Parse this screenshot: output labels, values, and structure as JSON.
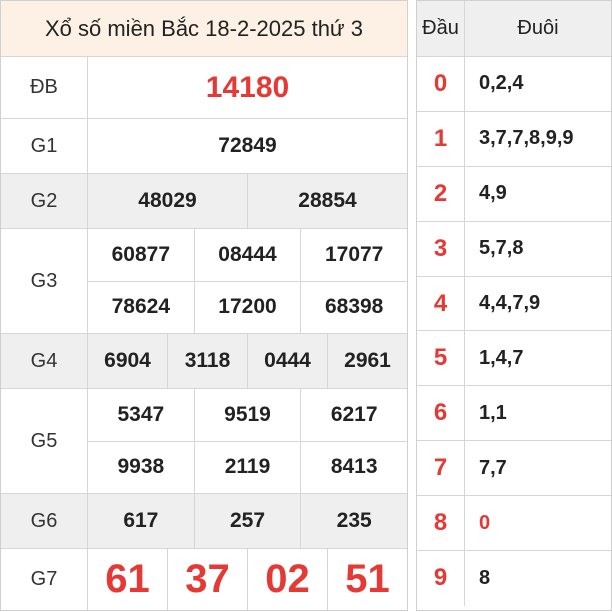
{
  "title": "Xổ số miền Bắc 18-2-2025 thứ 3",
  "prizes": {
    "db": {
      "label": "ĐB",
      "values": [
        "14180"
      ]
    },
    "g1": {
      "label": "G1",
      "values": [
        "72849"
      ]
    },
    "g2": {
      "label": "G2",
      "values": [
        "48029",
        "28854"
      ]
    },
    "g3": {
      "label": "G3",
      "values": [
        "60877",
        "08444",
        "17077",
        "78624",
        "17200",
        "68398"
      ]
    },
    "g4": {
      "label": "G4",
      "values": [
        "6904",
        "3118",
        "0444",
        "2961"
      ]
    },
    "g5": {
      "label": "G5",
      "values": [
        "5347",
        "9519",
        "6217",
        "9938",
        "2119",
        "8413"
      ]
    },
    "g6": {
      "label": "G6",
      "values": [
        "617",
        "257",
        "235"
      ]
    },
    "g7": {
      "label": "G7",
      "values": [
        "61",
        "37",
        "02",
        "51"
      ]
    }
  },
  "loto": {
    "head_label": "Đầu",
    "tail_label": "Đuôi",
    "rows": [
      {
        "head": "0",
        "tails": "0,2,4"
      },
      {
        "head": "1",
        "tails": "3,7,7,8,9,9"
      },
      {
        "head": "2",
        "tails": "4,9"
      },
      {
        "head": "3",
        "tails": "5,7,8"
      },
      {
        "head": "4",
        "tails": "4,4,7,9"
      },
      {
        "head": "5",
        "tails": "1,4,7"
      },
      {
        "head": "6",
        "tails": "1,1"
      },
      {
        "head": "7",
        "tails": "7,7"
      },
      {
        "head": "8",
        "tails": "0"
      },
      {
        "head": "9",
        "tails": "8"
      }
    ]
  },
  "colors": {
    "accent_red": "#e53935",
    "title_bg": "#fdf1e6",
    "shaded_bg": "#efefef"
  }
}
